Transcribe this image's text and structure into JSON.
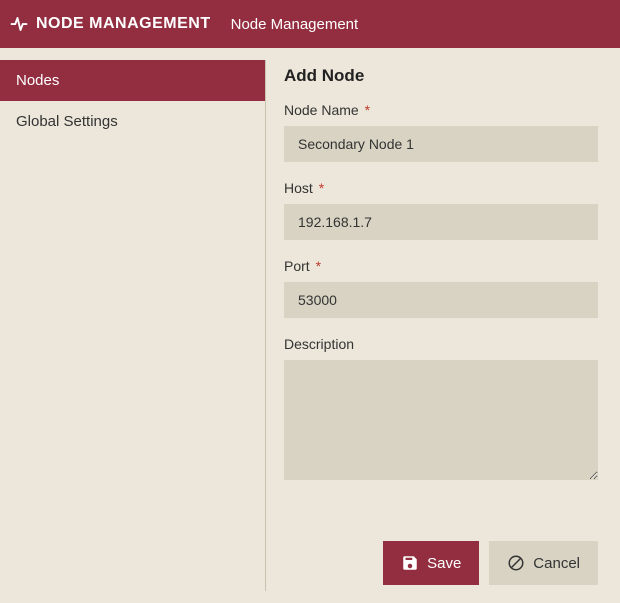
{
  "header": {
    "app_title": "NODE MANAGEMENT",
    "page_title": "Node Management"
  },
  "sidebar": {
    "items": [
      {
        "label": "Nodes",
        "active": true
      },
      {
        "label": "Global Settings",
        "active": false
      }
    ]
  },
  "form": {
    "heading": "Add Node",
    "fields": {
      "node_name": {
        "label": "Node Name",
        "required": true,
        "value": "Secondary Node 1"
      },
      "host": {
        "label": "Host",
        "required": true,
        "value": "192.168.1.7"
      },
      "port": {
        "label": "Port",
        "required": true,
        "value": "53000"
      },
      "description": {
        "label": "Description",
        "required": false,
        "value": ""
      }
    },
    "required_marker": "*"
  },
  "buttons": {
    "save": "Save",
    "cancel": "Cancel"
  },
  "colors": {
    "brand": "#932e41",
    "surface": "#ece7da",
    "input": "#d8d3c3"
  }
}
